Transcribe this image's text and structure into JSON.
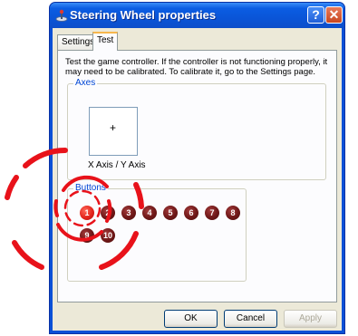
{
  "window": {
    "title": "Steering Wheel properties",
    "help_glyph": "?",
    "close_glyph": "✕",
    "icon": "joystick-icon"
  },
  "tabs": [
    {
      "label": "Settings",
      "selected": false
    },
    {
      "label": "Test",
      "selected": true
    }
  ],
  "panel": {
    "description": "Test the game controller.  If the controller is not functioning properly, it may need to be calibrated.  To calibrate it, go to the Settings page."
  },
  "axes": {
    "group_label": "Axes",
    "crosshair": "+",
    "label": "X Axis / Y Axis"
  },
  "buttons_group": {
    "group_label": "Buttons",
    "pressed": "1",
    "items": [
      "1",
      "2",
      "3",
      "4",
      "5",
      "6",
      "7",
      "8",
      "9",
      "10"
    ]
  },
  "footer": {
    "ok_label": "OK",
    "cancel_label": "Cancel",
    "apply_label": "Apply",
    "apply_enabled": false
  },
  "overlay": {
    "highlight_color": "#e8121a",
    "icon": "click-ripple-icon"
  }
}
